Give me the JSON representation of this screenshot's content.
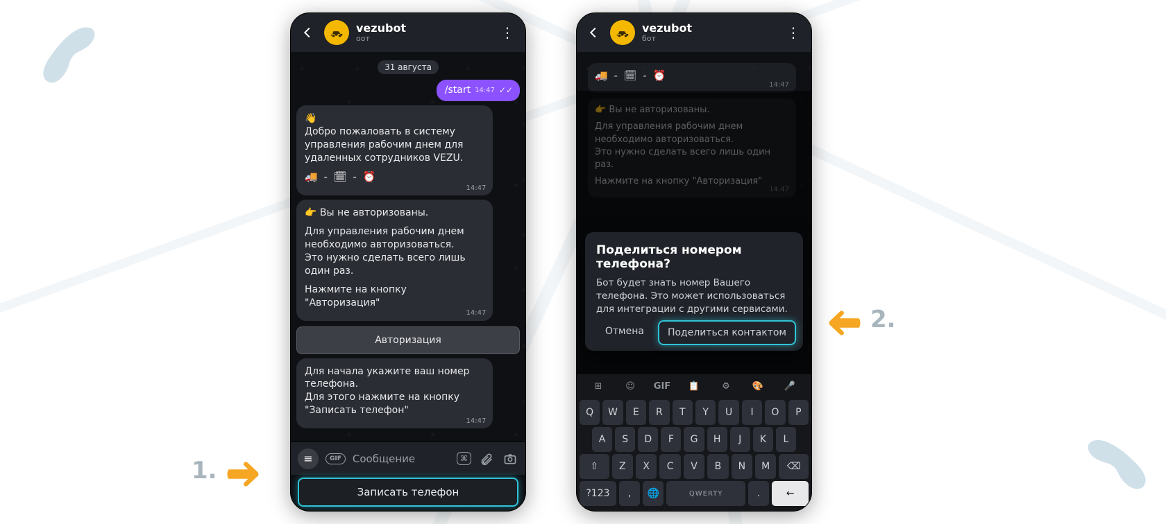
{
  "decor": {
    "step1": "1.",
    "step2": "2."
  },
  "phone1": {
    "header": {
      "title": "vezubot",
      "subtitle": "оот"
    },
    "date_separator": "31 августа",
    "out_msg": {
      "text": "/start",
      "time": "14:47"
    },
    "msg1": {
      "wave": "👋",
      "text": "Добро пожаловать в систему управления рабочим днем для удаленных сотрудников VEZU.",
      "emoji_line": "🚚 - 🗓 - ⏰",
      "time": "14:47"
    },
    "msg2": {
      "pointer": "👉",
      "line1": "Вы не авторизованы.",
      "para": "Для управления рабочим днем необходимо авторизоваться.\nЭто нужно сделать всего лишь один раз.",
      "cta_line": "Нажмите на кнопку \"Авторизация\"",
      "time": "14:47",
      "inline_button": "Авторизация"
    },
    "msg3": {
      "text": "Для начала укажите ваш номер телефона.\nДля этого нажмите на кнопку \"Записать телефон\"",
      "time": "14:47"
    },
    "composer": {
      "placeholder": "Сообщение"
    },
    "action_button": "Записать телефон"
  },
  "phone2": {
    "header": {
      "title": "vezubot",
      "subtitle": "бот"
    },
    "bg_msg1": {
      "emoji_line": "🚚 - 🗓 - ⏰",
      "time": "14:47"
    },
    "bg_msg2": {
      "pointer": "👉",
      "line1": "Вы не авторизованы.",
      "para": "Для управления рабочим днем необходимо авторизоваться.\nЭто нужно сделать всего лишь один раз.",
      "cta_line": "Нажмите на кнопку \"Авторизация\"",
      "time": "14:47"
    },
    "dialog": {
      "title": "Поделиться номером телефона?",
      "body": "Бот будет знать номер Вашего телефона. Это может использоваться для интеграции с другими сервисами.",
      "cancel": "Отмена",
      "share": "Поделиться контактом"
    },
    "keyboard": {
      "tools": [
        "⊞",
        "☺",
        "GIF",
        "📋",
        "⚙",
        "🎨",
        "🎤"
      ],
      "row1": [
        "Q",
        "W",
        "E",
        "R",
        "T",
        "Y",
        "U",
        "I",
        "O",
        "P"
      ],
      "row2": [
        "A",
        "S",
        "D",
        "F",
        "G",
        "H",
        "J",
        "K",
        "L"
      ],
      "row3_shift": "⇧",
      "row3": [
        "Z",
        "X",
        "C",
        "V",
        "B",
        "N",
        "M"
      ],
      "row3_back": "⌫",
      "row4": {
        "sym": "?123",
        "comma": ",",
        "lang": "🌐",
        "space": "QWERTY",
        "dot": ".",
        "enter": "←"
      }
    }
  }
}
